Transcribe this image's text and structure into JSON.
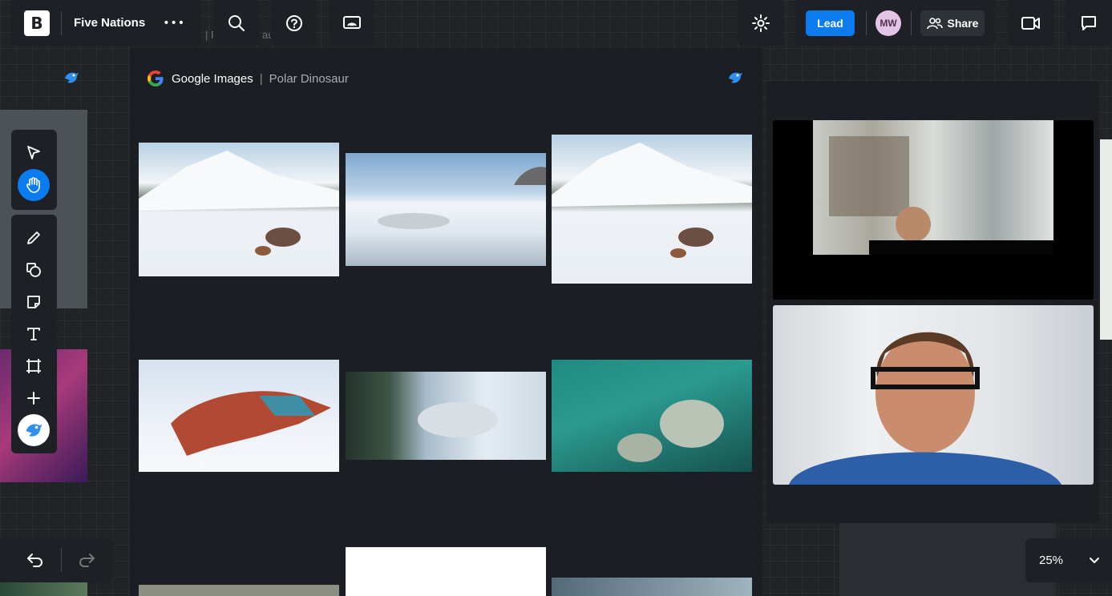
{
  "topbar": {
    "logo_letter": "B",
    "board_title": "Five Nations",
    "more_label": "•••",
    "lead_label": "Lead",
    "avatar_initials": "MW",
    "share_label": "Share",
    "bg_hint": "| P",
    "bg_hint2": "au"
  },
  "colors": {
    "accent": "#0a7cf0",
    "panel": "#1d2125",
    "canvas": "#202427",
    "avatar_bg": "#e5c3e7"
  },
  "icons": [
    "search-icon",
    "help-icon",
    "cast-icon",
    "sparkle-icon",
    "video-camera-icon",
    "chat-icon",
    "cursor-icon",
    "hand-icon",
    "pen-icon",
    "shapes-icon",
    "sticky-note-icon",
    "text-icon",
    "frame-icon",
    "plus-icon",
    "bird-icon",
    "undo-icon",
    "redo-icon",
    "chevron-down-icon"
  ],
  "google_card": {
    "source": "Google Images",
    "separator": "|",
    "query": "Polar Dinosaur"
  },
  "zoom": {
    "level": "25%"
  }
}
